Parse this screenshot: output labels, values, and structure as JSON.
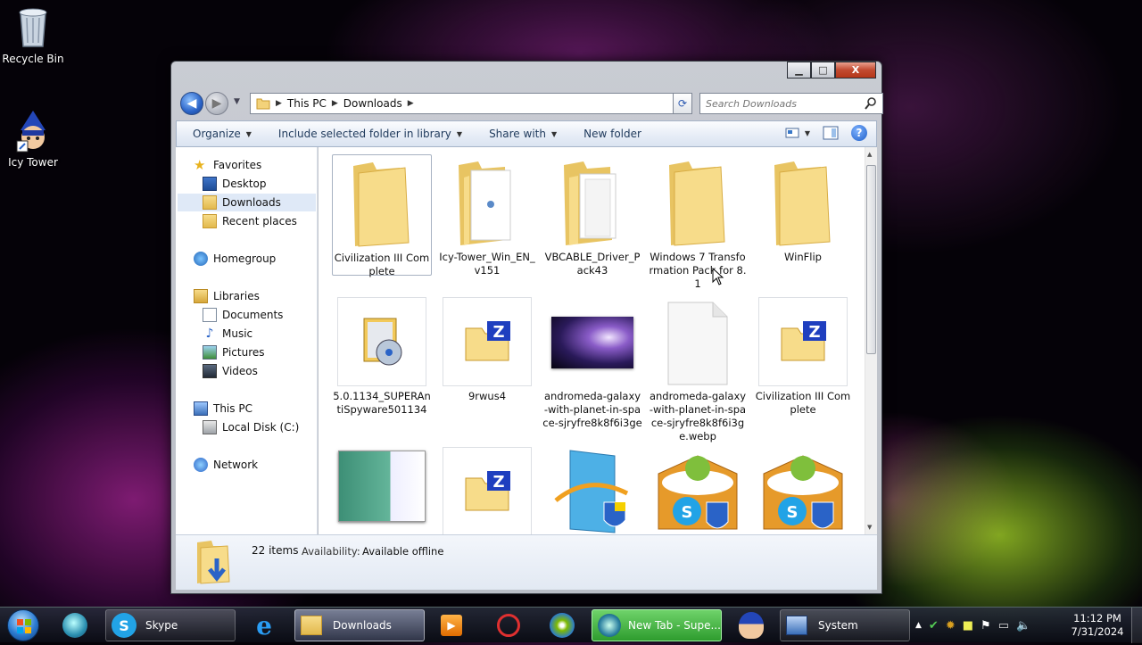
{
  "desktop": {
    "icons": [
      {
        "label": "Recycle Bin"
      },
      {
        "label": "Icy Tower"
      }
    ]
  },
  "window": {
    "caption_buttons": {
      "minimize": "▁",
      "maximize": "□",
      "close": "X"
    },
    "breadcrumb": [
      "This PC",
      "Downloads"
    ],
    "search_placeholder": "Search Downloads",
    "toolbar": {
      "organize": "Organize",
      "include": "Include selected folder in library",
      "share": "Share with",
      "new_folder": "New folder"
    },
    "nav_pane": {
      "favorites": "Favorites",
      "desktop": "Desktop",
      "downloads": "Downloads",
      "recent": "Recent places",
      "homegroup": "Homegroup",
      "libraries": "Libraries",
      "documents": "Documents",
      "music": "Music",
      "pictures": "Pictures",
      "videos": "Videos",
      "this_pc": "This PC",
      "local_disk": "Local Disk (C:)",
      "network": "Network"
    },
    "files": [
      {
        "name": "Civilization III Complete",
        "icon": "folder-icon"
      },
      {
        "name": "Icy-Tower_Win_EN_v151",
        "icon": "folder-icon"
      },
      {
        "name": "VBCABLE_Driver_Pack43",
        "icon": "folder-icon"
      },
      {
        "name": "Windows 7 Transformation Pack for 8.1",
        "icon": "folder-icon"
      },
      {
        "name": "WinFlip",
        "icon": "folder-icon"
      },
      {
        "name": "5.0.1134_SUPERAntiSpyware501134",
        "icon": "installer-icon"
      },
      {
        "name": "9rwus4",
        "icon": "zip-icon"
      },
      {
        "name": "andromeda-galaxy-with-planet-in-space-sjryfre8k8f6i3ge",
        "icon": "image-thumbnail"
      },
      {
        "name": "andromeda-galaxy-with-planet-in-space-sjryfre8k8f6i3ge.webp",
        "icon": "blank-file-icon"
      },
      {
        "name": "Civilization III Complete",
        "icon": "zip-icon"
      },
      {
        "name": "",
        "icon": "document-thumbnail"
      },
      {
        "name": "",
        "icon": "zip-icon"
      },
      {
        "name": "",
        "icon": "setup-icon"
      },
      {
        "name": "",
        "icon": "skype-installer-icon"
      },
      {
        "name": "",
        "icon": "skype-installer-icon"
      }
    ],
    "details": {
      "count": "22 items",
      "availability_label": "Availability:",
      "availability_value": "Available offline"
    }
  },
  "taskbar": {
    "skype": "Skype",
    "downloads": "Downloads",
    "newtab": "New Tab - Supe...",
    "system": "System",
    "time": "11:12 PM",
    "date": "7/31/2024"
  },
  "colors": {
    "accent": "#2a63c7",
    "folder_light": "#f7dc8a",
    "folder_dark": "#e2b94d",
    "zip_blue": "#1f3fbf"
  }
}
